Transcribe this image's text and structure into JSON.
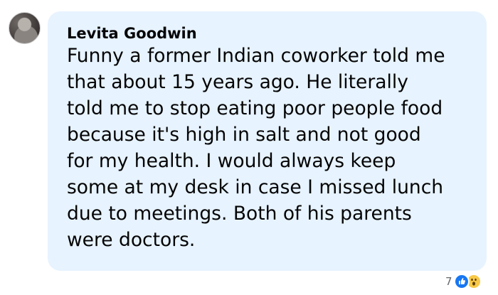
{
  "comment": {
    "author": "Levita Goodwin",
    "lines": [
      "Funny a former Indian coworker told me",
      "that about 15 years ago. He literally",
      "told me to stop eating poor people food",
      "because it's high in salt and not good",
      "for my health. I would always keep",
      "some at my desk in case I missed lunch",
      "due to meetings. Both of his parents",
      "were doctors."
    ]
  },
  "reactions": {
    "count": "7",
    "icons": [
      "like-icon",
      "wow-icon"
    ],
    "colors": {
      "like": "#1877f2",
      "wow": "#f7c948"
    }
  },
  "colors": {
    "bubble": "#e7f3ff",
    "text": "#050505"
  }
}
